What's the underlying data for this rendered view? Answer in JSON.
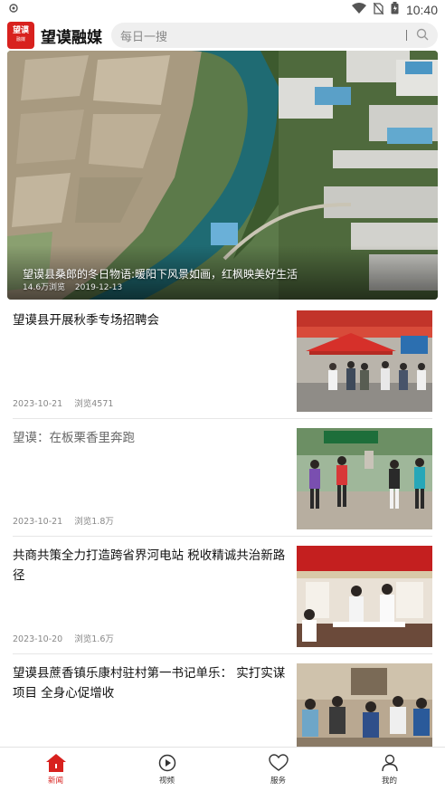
{
  "status_bar": {
    "time": "10:40"
  },
  "header": {
    "logo_text": "望谟",
    "logo_sub": "融媒",
    "app_title": "望谟融媒",
    "search_placeholder": "每日一搜"
  },
  "banner": {
    "caption": "望谟县桑郎的冬日物语:暖阳下风景如画，红枫映美好生活",
    "views": "14.6万浏览",
    "date": "2019-12-13"
  },
  "articles": [
    {
      "title": "望谟县开展秋季专场招聘会",
      "date": "2023-10-21",
      "views": "浏览4571"
    },
    {
      "title": "望谟：在板栗香里奔跑",
      "date": "2023-10-21",
      "views": "浏览1.8万"
    },
    {
      "title": "共商共策全力打造跨省界河电站 税收精诚共治新路径",
      "date": "2023-10-20",
      "views": "浏览1.6万"
    },
    {
      "title": "望谟县蔗香镇乐康村驻村第一书记单乐： 实打实谋项目 全身心促增收",
      "date": "",
      "views": ""
    }
  ],
  "bottom_nav": [
    {
      "label": "新闻",
      "icon": "home-icon"
    },
    {
      "label": "视频",
      "icon": "play-icon"
    },
    {
      "label": "服务",
      "icon": "heart-icon"
    },
    {
      "label": "我的",
      "icon": "user-icon"
    }
  ],
  "colors": {
    "accent": "#d8211e"
  }
}
